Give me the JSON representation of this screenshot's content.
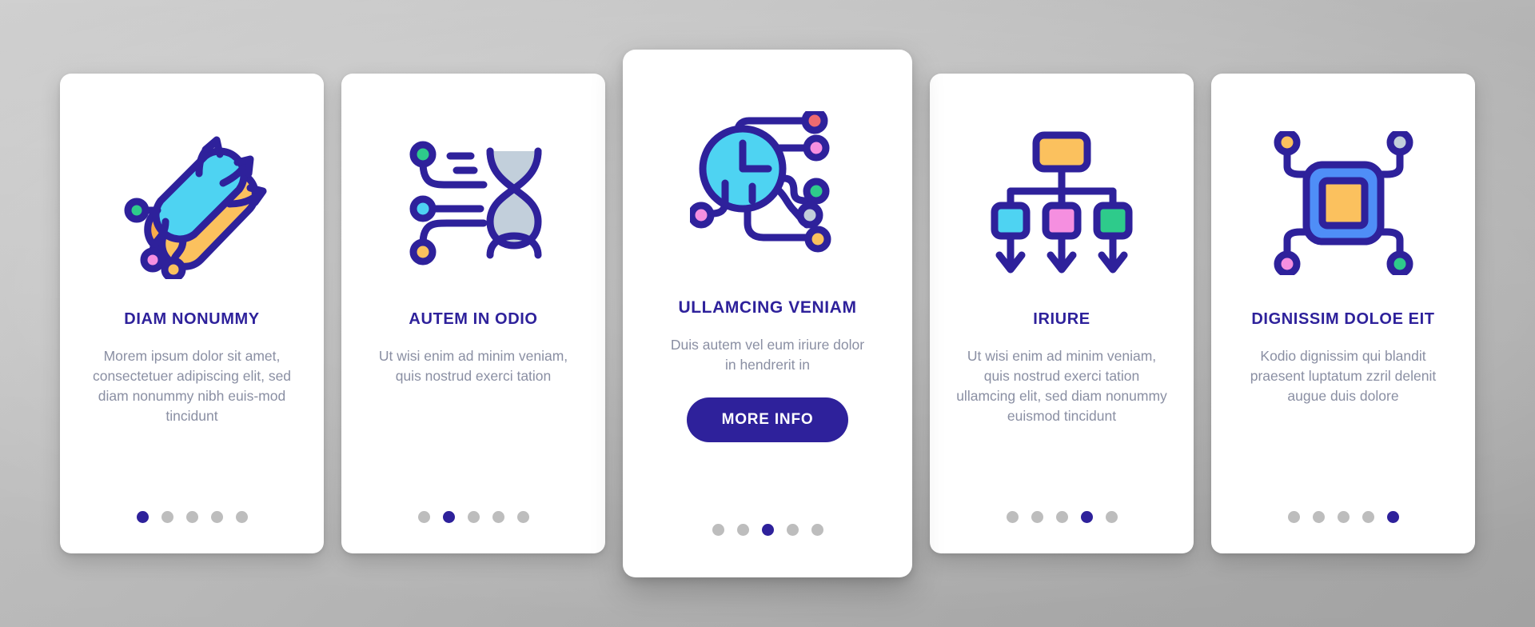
{
  "theme": {
    "accent": "#2e219b",
    "body_text": "#8a8fa3",
    "dot_inactive": "#bdbdbd",
    "card_bg": "#ffffff",
    "page_bg": "#c9c9c9",
    "icon_stroke": "#2e219b",
    "icon_cyan": "#4ed3f2",
    "icon_orange": "#f9ab4a",
    "icon_yellow": "#fbc15e",
    "icon_pink": "#f58fe0",
    "icon_green": "#2ecb8b",
    "icon_gray": "#c2cfdb",
    "icon_blue": "#4f8ef7",
    "icon_red": "#ef6b70"
  },
  "cards": [
    {
      "id": "card-diam-nonummy",
      "icon_name": "neural-nodes-arrows-icon",
      "title": "DIAM NONUMMY",
      "body": "Morem ipsum dolor sit amet, consectetuer adipiscing elit, sed diam nonummy nibh euis-mod tincidunt",
      "featured": false,
      "dots": {
        "count": 5,
        "active_index": 0
      }
    },
    {
      "id": "card-autem-in-odio",
      "icon_name": "dna-helix-circuit-icon",
      "title": "AUTEM IN ODIO",
      "body": "Ut wisi enim ad minim veniam, quis nostrud exerci tation",
      "featured": false,
      "dots": {
        "count": 5,
        "active_index": 1
      }
    },
    {
      "id": "card-ullamcing-veniam",
      "icon_name": "neural-network-node-icon",
      "title": "ULLAMCING VENIAM",
      "body": "Duis autem vel eum iriure dolor in hendrerit in",
      "featured": true,
      "cta_label": "MORE INFO",
      "dots": {
        "count": 5,
        "active_index": 2
      }
    },
    {
      "id": "card-iriure",
      "icon_name": "hierarchy-flowchart-icon",
      "title": "IRIURE",
      "body": "Ut wisi enim ad minim veniam, quis nostrud exerci tation ullamcing elit, sed diam nonummy euismod tincidunt",
      "featured": false,
      "dots": {
        "count": 5,
        "active_index": 3
      }
    },
    {
      "id": "card-dignissim-doloe-eit",
      "icon_name": "cpu-chip-icon",
      "title": "DIGNISSIM DOLOE EIT",
      "body": "Kodio dignissim qui blandit praesent luptatum zzril delenit augue duis dolore",
      "featured": false,
      "dots": {
        "count": 5,
        "active_index": 4
      }
    }
  ]
}
